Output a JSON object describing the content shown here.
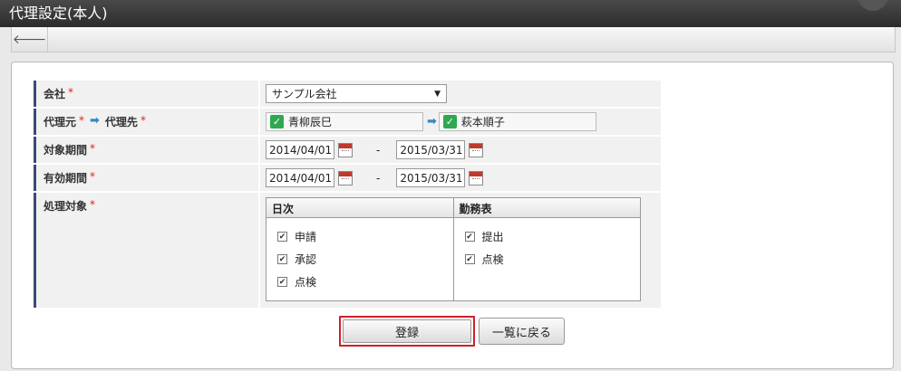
{
  "header": {
    "title": "代理設定(本人)"
  },
  "toolbar": {
    "back_icon": "left-arrow-icon",
    "back_glyph": "🡐"
  },
  "form": {
    "company": {
      "label": "会社",
      "required": "*",
      "selected": "サンプル会社"
    },
    "delegate": {
      "from_label": "代理元",
      "to_label": "代理先",
      "required": "*",
      "from_user": "青柳辰巳",
      "to_user": "萩本順子"
    },
    "target_period": {
      "label": "対象期間",
      "required": "*",
      "start": "2014/04/01",
      "end": "2015/03/31",
      "separator": "-"
    },
    "valid_period": {
      "label": "有効期間",
      "required": "*",
      "start": "2014/04/01",
      "end": "2015/03/31",
      "separator": "-"
    },
    "process_target": {
      "label": "処理対象",
      "required": "*",
      "columns": [
        {
          "header": "日次",
          "items": [
            "申請",
            "承認",
            "点検"
          ]
        },
        {
          "header": "勤務表",
          "items": [
            "提出",
            "点検"
          ]
        }
      ]
    }
  },
  "buttons": {
    "register": "登録",
    "back_to_list": "一覧に戻る"
  },
  "colors": {
    "accent_border": "#3a4a7a",
    "required": "#dd2222",
    "highlight": "#d0202a",
    "check_green": "#2fa84f",
    "arrow_blue": "#3b86c9"
  }
}
